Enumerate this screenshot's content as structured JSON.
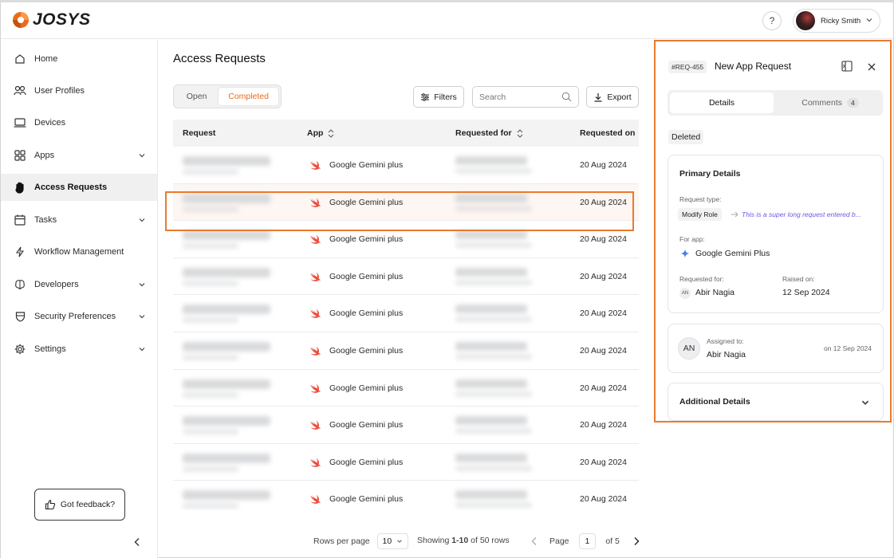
{
  "brand": {
    "name": "JOSYS",
    "accent": "#ea6b1e"
  },
  "user": {
    "name": "Ricky Smith"
  },
  "sidebar": {
    "items": [
      {
        "label": "Home",
        "icon": "home-icon"
      },
      {
        "label": "User Profiles",
        "icon": "users-icon"
      },
      {
        "label": "Devices",
        "icon": "laptop-icon"
      },
      {
        "label": "Apps",
        "icon": "grid-icon"
      },
      {
        "label": "Access Requests",
        "icon": "hand-icon"
      },
      {
        "label": "Tasks",
        "icon": "calendar-icon"
      },
      {
        "label": "Workflow Management",
        "icon": "lightning-icon"
      },
      {
        "label": "Developers",
        "icon": "brain-icon"
      },
      {
        "label": "Security Preferences",
        "icon": "shield-icon"
      },
      {
        "label": "Settings",
        "icon": "gear-icon"
      }
    ],
    "active": "Access Requests",
    "feedback_label": "Got feedback?"
  },
  "main": {
    "title": "Access Requests",
    "tabs": [
      {
        "label": "Open"
      },
      {
        "label": "Completed"
      }
    ],
    "filters_label": "Filters",
    "search_placeholder": "Search",
    "export_label": "Export",
    "columns": [
      "Request",
      "App",
      "Requested for",
      "Requested on"
    ],
    "rows": [
      {
        "app": "Google Gemini plus",
        "date": "20 Aug 2024"
      },
      {
        "app": "Google Gemini plus",
        "date": "20 Aug 2024"
      },
      {
        "app": "Google Gemini plus",
        "date": "20 Aug 2024"
      },
      {
        "app": "Google Gemini plus",
        "date": "20 Aug 2024"
      },
      {
        "app": "Google Gemini plus",
        "date": "20 Aug 2024"
      },
      {
        "app": "Google Gemini plus",
        "date": "20 Aug 2024"
      },
      {
        "app": "Google Gemini plus",
        "date": "20 Aug 2024"
      },
      {
        "app": "Google Gemini plus",
        "date": "20 Aug 2024"
      },
      {
        "app": "Google Gemini plus",
        "date": "20 Aug 2024"
      },
      {
        "app": "Google Gemini plus",
        "date": "20 Aug 2024"
      }
    ],
    "pagination": {
      "rows_per_page_label": "Rows per page",
      "rows_per_page": "10",
      "showing_prefix": "Showing",
      "showing_range": "1-10",
      "showing_suffix": "of 50 rows",
      "page_label": "Page",
      "page": "1",
      "of_pages": "of 5"
    }
  },
  "panel": {
    "req_id": "#REQ-455",
    "title": "New App Request",
    "tabs": {
      "details": "Details",
      "comments": "Comments",
      "comments_count": "4"
    },
    "status": "Deleted",
    "primary": {
      "heading": "Primary Details",
      "request_type_label": "Request type:",
      "request_type": "Modify Role",
      "request_note": "This is a super long request entered b...",
      "for_app_label": "For app:",
      "for_app": "Google Gemini Plus",
      "requested_for_label": "Requested for:",
      "requested_for_initials": "AN",
      "requested_for": "Abir Nagia",
      "raised_on_label": "Raised on:",
      "raised_on": "12 Sep 2024"
    },
    "assigned": {
      "initials": "AN",
      "label": "Assigned to:",
      "name": "Abir Nagia",
      "date": "on 12 Sep 2024"
    },
    "additional": {
      "heading": "Additional Details"
    }
  }
}
